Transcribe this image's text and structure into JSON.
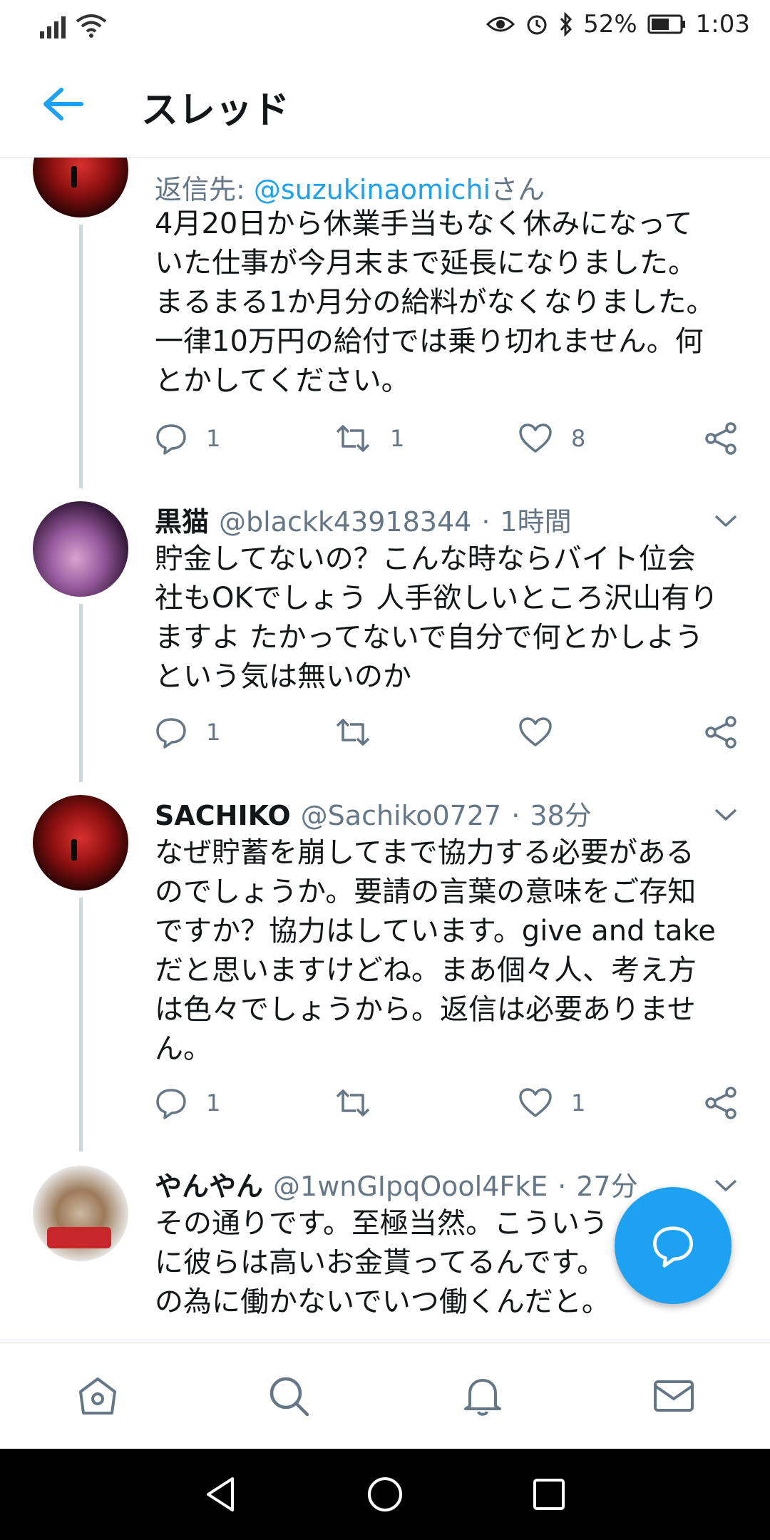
{
  "status_bar": {
    "battery": "52%",
    "time": "1:03",
    "icons": [
      "signal-icon",
      "wifi-icon",
      "eye-icon",
      "alarm-icon",
      "bluetooth-icon",
      "battery-icon"
    ]
  },
  "header": {
    "title": "スレッド",
    "back_icon": "arrow-left-icon"
  },
  "tweets": [
    {
      "reply_prefix": "返信先: ",
      "reply_handle": "@suzukinaomichi",
      "reply_suffix": "さん",
      "lines": [
        "4月20日から休業手当もなく休みになって",
        "いた仕事が今月末まで延長になりました。",
        "まるまる1か月分の給料がなくなりました。",
        "一律10万円の給付では乗り切れません。何",
        "とかしてください。"
      ],
      "replies": "1",
      "retweets": "1",
      "likes": "8"
    },
    {
      "name": "黒猫",
      "handle": "@blackk43918344",
      "dot": "·",
      "time": "1時間",
      "lines": [
        "貯金してないの？こんな時ならバイト位会",
        "社もOKでしょう 人手欲しいところ沢山有り",
        "ますよ たかってないで自分で何とかしよう",
        "という気は無いのか"
      ],
      "replies": "1",
      "retweets": "",
      "likes": ""
    },
    {
      "name": "SACHIKO",
      "handle": "@Sachiko0727",
      "dot": "·",
      "time": "38分",
      "lines": [
        "なぜ貯蓄を崩してまで協力する必要がある",
        "のでしょうか。要請の言葉の意味をご存知",
        "ですか？協力はしています。give and take",
        "だと思いますけどね。まあ個々人、考え方",
        "は色々でしょうから。返信は必要ありませ",
        "ん。"
      ],
      "replies": "1",
      "retweets": "",
      "likes": "1"
    },
    {
      "name": "やんやん",
      "handle": "@1wnGIpqOool4FkE",
      "dot": "·",
      "time": "27分",
      "lines": [
        "その通りです。至極当然。こういう",
        "に彼らは高いお金貰ってるんです。",
        "の為に働かないでいつ働くんだと。"
      ]
    }
  ],
  "colors": {
    "accent": "#1da1f2",
    "secondary_text": "#657786",
    "divider": "#e1e8ed"
  }
}
